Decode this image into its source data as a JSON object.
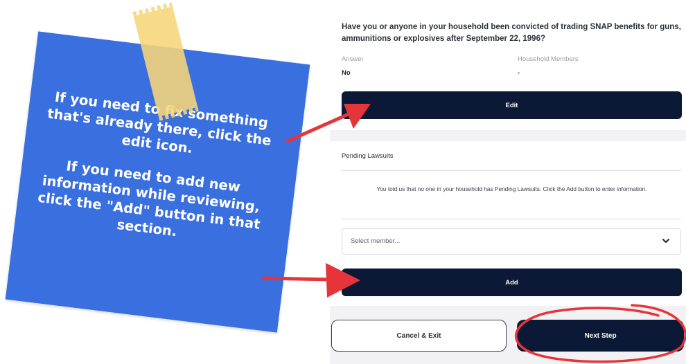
{
  "note": {
    "paragraph1": "If you need to fix something that's already there, click the edit icon.",
    "paragraph2": "If you need to add new information while reviewing, click the \"Add\" button in that section.",
    "color": "#3a6fe0",
    "tape_color": "#f7d678"
  },
  "question_card": {
    "question": "Have you or anyone in your household been convicted of trading SNAP benefits for guns, ammunitions or explosives after September 22, 1996?",
    "answer_label": "Answer",
    "answer_value": "No",
    "members_label": "Household Members",
    "members_value": "-",
    "edit_label": "Edit"
  },
  "lawsuits_card": {
    "title": "Pending Lawsuits",
    "info": "You told us that no one in your household has Pending Lawsuits. Click the Add button to enter information.",
    "select_placeholder": "Select member...",
    "add_label": "Add"
  },
  "footer": {
    "cancel_label": "Cancel & Exit",
    "next_label": "Next Step"
  },
  "colors": {
    "navy": "#0b1836",
    "annotation_red": "#e5343a"
  },
  "icons": {
    "select_chevron": "chevron-down-icon"
  }
}
